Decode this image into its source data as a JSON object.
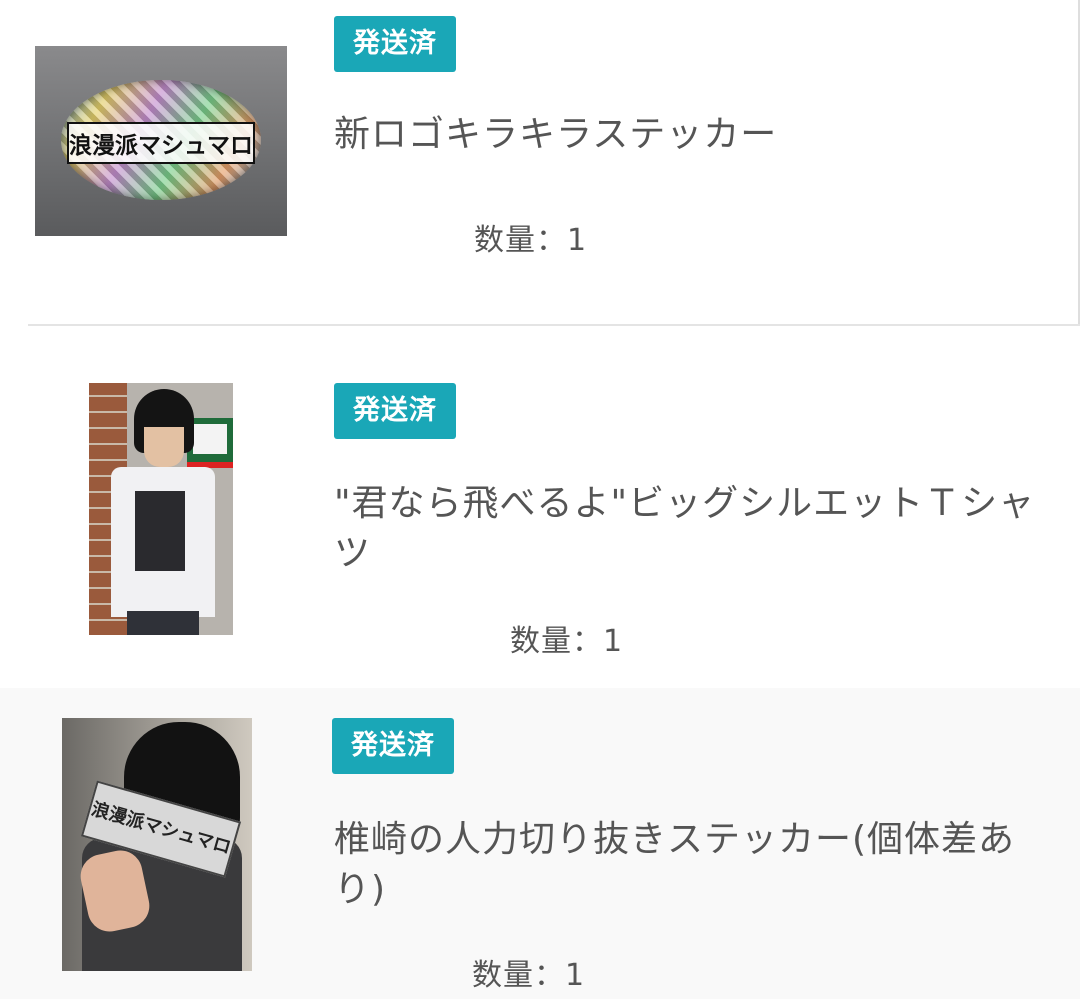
{
  "items": [
    {
      "status": "発送済",
      "title": "新ロゴキラキラステッカー",
      "quantity": "数量：1",
      "thumbnail_text": "浪漫派マシュマロ"
    },
    {
      "status": "発送済",
      "title": "\"君なら飛べるよ\"ビッグシルエットＴシャツ",
      "quantity": "数量：1"
    },
    {
      "status": "発送済",
      "title": "椎崎の人力切り抜きステッカー(個体差あり)",
      "quantity": "数量：1",
      "thumbnail_text": "浪漫派マシュマロ"
    }
  ],
  "colors": {
    "status_badge": "#1aa7b7",
    "text": "#555555"
  }
}
